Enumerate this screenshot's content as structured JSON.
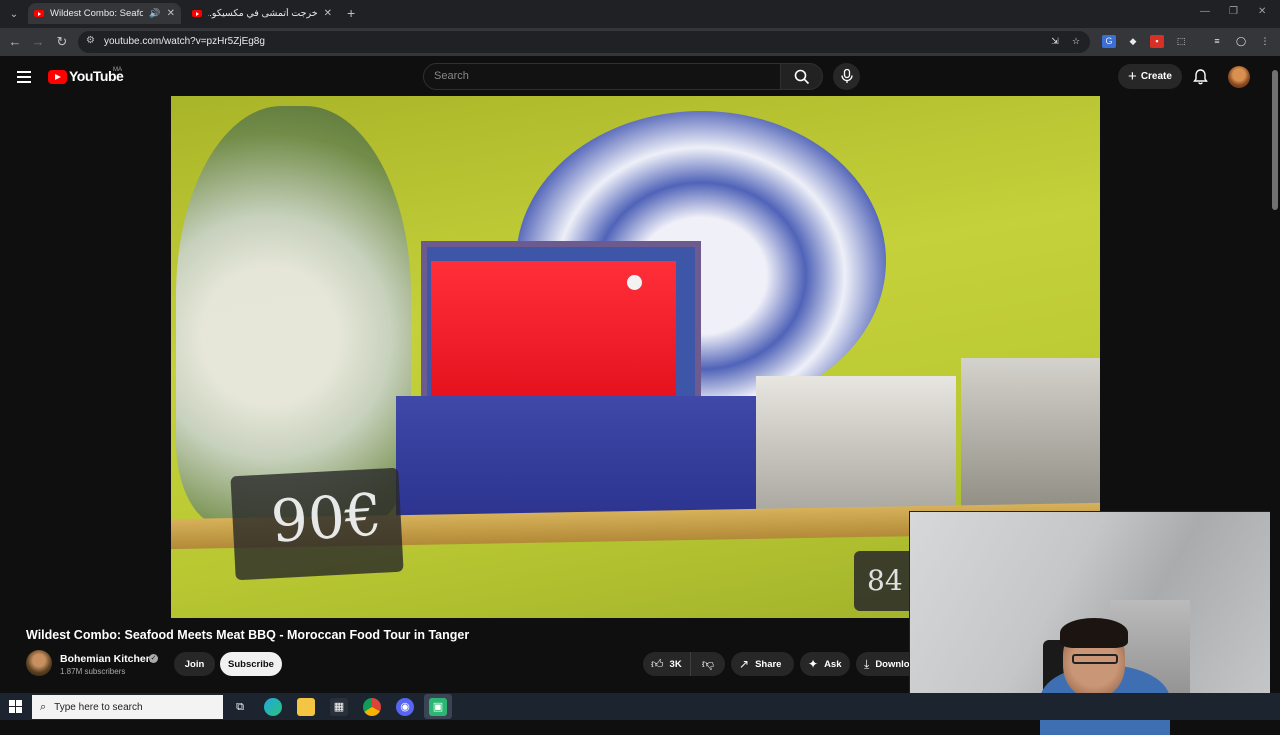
{
  "browser": {
    "tabs": [
      {
        "title": "Wildest Combo: Seafood M",
        "active": true
      },
      {
        "title": "خرجت أتمشى في مكسيكو... وتعر",
        "active": false
      }
    ],
    "new_tab_glyph": "+",
    "url": "youtube.com/watch?v=pzHr5ZjEg8g"
  },
  "youtube": {
    "logo_text": "YouTube",
    "country_code": "MA",
    "search_placeholder": "Search",
    "create_label": "Create"
  },
  "video": {
    "title": "Wildest Combo: Seafood Meets Meat BBQ - Moroccan Food Tour in Tanger",
    "price_tag_1": "90€",
    "price_tag_2": "84"
  },
  "channel": {
    "name": "Bohemian Kitchen",
    "subscribers": "1.87M subscribers",
    "join_label": "Join",
    "subscribe_label": "Subscribe"
  },
  "actions": {
    "likes": "3K",
    "share_label": "Share",
    "ask_label": "Ask",
    "download_label": "Download"
  },
  "taskbar": {
    "search_placeholder": "Type here to search"
  },
  "colors": {
    "yt_red": "#ff0000",
    "background": "#0f0f0f",
    "pill": "#272727"
  },
  "icons": [
    "tab-search-icon",
    "youtube-favicon-icon",
    "speaker-icon",
    "close-icon",
    "back-icon",
    "forward-icon",
    "reload-icon",
    "site-info-icon",
    "install-icon",
    "bookmark-star-icon",
    "translate-icon",
    "extension-icon",
    "puzzle-icon",
    "media-icon",
    "profile-icon",
    "menu-icon",
    "hamburger-icon",
    "search-icon",
    "mic-icon",
    "bell-icon",
    "verified-icon",
    "like-icon",
    "dislike-icon",
    "share-icon",
    "ask-icon",
    "download-icon",
    "windows-start-icon",
    "task-view-icon",
    "edge-icon",
    "file-explorer-icon",
    "store-icon",
    "chrome-icon",
    "discord-icon",
    "app-icon"
  ]
}
